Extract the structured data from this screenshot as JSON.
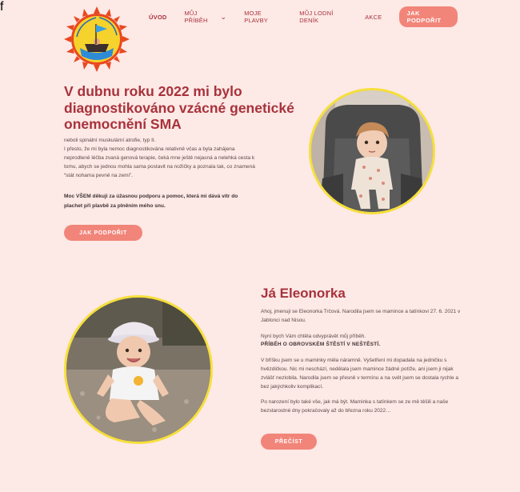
{
  "logo": {
    "text": "Vítr do plachet pro Eleonorku",
    "colors": {
      "sun": "#f6d22c",
      "rays": "#e8481f",
      "sea": "#2f8bd6",
      "flag": "#3aa0e0"
    }
  },
  "nav": {
    "items": [
      {
        "label": "ÚVOD",
        "active": true
      },
      {
        "label": "MŮJ PŘÍBĚH",
        "has_dropdown": true
      },
      {
        "label": "MOJE PLAVBY"
      },
      {
        "label": "MŮJ LODNÍ DENÍK"
      },
      {
        "label": "AKCE"
      }
    ],
    "support_label": "JAK PODPOŘIT",
    "social": [
      "facebook-icon",
      "instagram-icon"
    ]
  },
  "hero": {
    "title": "V dubnu roku 2022 mi bylo diagnostikováno vzácné genetické onemocnění SMA",
    "line1": "neboli spinální muskulární atrofie, typ II.",
    "paragraph": "I přesto, že mi byla nemoc diagnostikována relativně včas a byla zahájena neprodleně léčba zvaná genová terapie, čeká mne ještě nejasná a nelehká cesta k tomu, abych se jednou mohla sama postavit na nožičky a poznala tak, co znamená “stát nohama pevně na zemi”.",
    "thanks": "Moc VŠEM děkuji za úžasnou podporu a pomoc, která mi dává vítr do plachet při plavbě za plněním mého snu.",
    "button": "JAK PODPOŘIT"
  },
  "about": {
    "title": "Já Eleonorka",
    "p1": "Ahoj, jmenuji se Eleonorka Trčová. Narodila jsem se mamince a tatínkovi 27. 6. 2021 v Jablonci nad Nisou.",
    "p2": "Nyní bych Vám chtěla odvyprávět můj příběh.",
    "p2_strong": "PŘÍBĚH O OBROVSKÉM ŠTĚSTÍ V NEŠTĚSTÍ.",
    "p3": "V bříšku jsem se u maminky měla náramně. Vyšetření mi dopadala na jedničku s hvězdičkou. Nic mi neschází, nedělala jsem mamince žádné potíže, ani jsem ji nijak zvlášť nezlobila. Narodila jsem se přesně v termínu a na svět jsem se dostala rychle a bez jakýchkoliv komplikací.",
    "p4": "Po narození bylo také vše, jak má být. Maminka s tatínkem se ze mě těšili a naše bezstarostné dny pokračovaly až do března roku 2022…",
    "button": "PŘEČÍST"
  }
}
